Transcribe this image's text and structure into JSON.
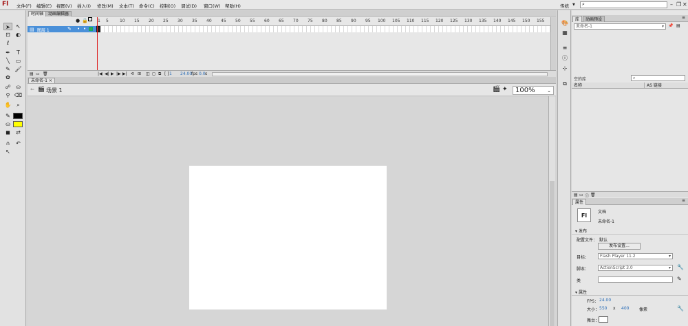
{
  "menubar": {
    "logo": "Fl",
    "items": [
      "文件(F)",
      "编辑(E)",
      "视图(V)",
      "插入(I)",
      "修改(M)",
      "文本(T)",
      "命令(C)",
      "控制(O)",
      "调试(D)",
      "窗口(W)",
      "帮助(H)"
    ],
    "workspace": "传统",
    "search_placeholder": ""
  },
  "timeline": {
    "tabs": [
      "时间轴",
      "动画编辑器"
    ],
    "layer_name": "图层 1",
    "frame_numbers": [
      "1",
      "5",
      "10",
      "15",
      "20",
      "25",
      "30",
      "35",
      "40",
      "45",
      "50",
      "55",
      "60",
      "65",
      "70",
      "75",
      "80",
      "85",
      "90",
      "95",
      "100",
      "105",
      "110",
      "115",
      "120",
      "125",
      "130",
      "135",
      "140",
      "145",
      "150",
      "155"
    ],
    "fps": "24.00",
    "fps_unit": "fps",
    "time": "0.0",
    "time_unit": "s",
    "current_frame": "1"
  },
  "document": {
    "tab_name": "未命名-1",
    "scene": "场景 1",
    "zoom": "100%",
    "stage_color": "#ffffff"
  },
  "library": {
    "tabs": [
      "库",
      "动画预设"
    ],
    "doc_select": "未命名-1",
    "item_count": "空的库",
    "col_name": "名称",
    "col_linkage": "AS 链接"
  },
  "properties": {
    "tab": "属性",
    "icon_text": "Fl",
    "doc_type": "文档",
    "doc_name": "未命名-1",
    "section_publish": "发布",
    "profile_label": "配置文件：",
    "profile_value": "默认",
    "publish_settings": "发布设置...",
    "target_label": "目标：",
    "target_value": "Flash Player 11.2",
    "script_label": "脚本：",
    "script_value": "ActionScript 3.0",
    "class_label": "类",
    "section_props": "属性",
    "fps_label": "FPS：",
    "fps_value": "24.00",
    "size_label": "大小：",
    "width": "550",
    "x": "x",
    "height": "400",
    "units": "像素",
    "stage_label": "舞台："
  },
  "colors": {
    "fill": "#ffff00",
    "stroke": "#000000",
    "selected_layer": "#4a90d9",
    "playhead": "#dd2222"
  }
}
